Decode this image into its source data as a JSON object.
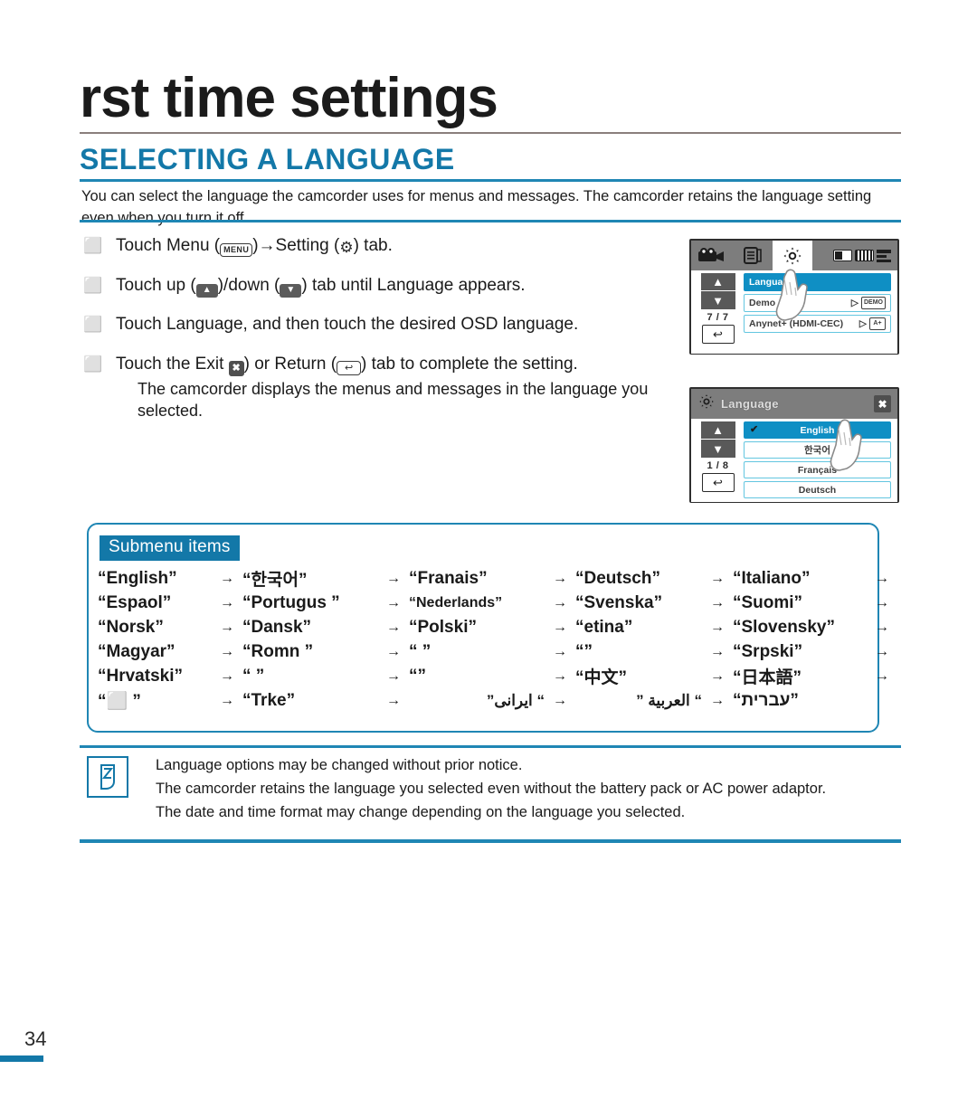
{
  "header": {
    "chapter_title": "rst time settings",
    "section_title": "SELECTING A LANGUAGE",
    "intro": "You can select the language the camcorder uses for menus and messages. The camcorder retains the language setting even when you turn it off."
  },
  "steps": [
    {
      "bullet": "⬜",
      "pre": "Touch Menu (",
      "icon1": "MENU",
      "mid": ")→Setting (",
      "icon2": "⚙",
      "post": ") tab."
    },
    {
      "bullet": "⬜",
      "pre": "Touch up (",
      "icon1": "▲",
      "mid": ")/down (",
      "icon2": "▼",
      "post": ") tab until  Language  appears."
    },
    {
      "bullet": "⬜",
      "text": "Touch  Language,  and then touch the desired OSD language."
    },
    {
      "bullet": "⬜",
      "pre": "Touch the Exit ",
      "icon1": "✖",
      "mid": ") or Return (",
      "icon2": "↩",
      "post": ") tab to complete the setting.",
      "sub": "The camcorder displays the menus and messages in the language you selected."
    }
  ],
  "lcd_setting": {
    "tabs": {
      "camera_icon": "camcorder-icon",
      "list_icon": "playback-icon",
      "gear_icon": "setting-icon"
    },
    "status_icons": [
      "memory-icon",
      "battery-icon",
      "card-icon"
    ],
    "nav": {
      "up": "▲",
      "down": "▼",
      "page": "7 / 7",
      "return": "↩"
    },
    "rows": [
      {
        "label": "Language",
        "selected": true,
        "value": "",
        "badge": ""
      },
      {
        "label": "Demo",
        "selected": false,
        "value": "▷",
        "badge": "DEMO"
      },
      {
        "label": "Anynet+ (HDMI-CEC)",
        "selected": false,
        "value": "▷",
        "badge": "A+"
      }
    ]
  },
  "lcd_language": {
    "header_title": "Language",
    "header_gear_icon": "setting-icon",
    "close_icon": "✖",
    "nav": {
      "up": "▲",
      "down": "▼",
      "page": "1 / 8",
      "return": "↩"
    },
    "rows": [
      {
        "label": "English",
        "selected": true,
        "check": "✔"
      },
      {
        "label": "한국어",
        "selected": false,
        "check": ""
      },
      {
        "label": "Français",
        "selected": false,
        "check": ""
      },
      {
        "label": "Deutsch",
        "selected": false,
        "check": ""
      }
    ]
  },
  "submenu": {
    "label": "Submenu items",
    "arrow": "→",
    "rows": [
      [
        "“English”",
        "“한국어”",
        "“Franais”",
        "“Deutsch”",
        "“Italiano”"
      ],
      [
        "“Espaol”",
        "“Portugus ”",
        "“Nederlands”",
        "“Svenska”",
        "“Suomi”"
      ],
      [
        "“Norsk”",
        "“Dansk”",
        "“Polski”",
        "“etina”",
        "“Slovensky”"
      ],
      [
        "“Magyar”",
        "“Romn  ”",
        "“           ”",
        "“”",
        "“Srpski”"
      ],
      [
        "“Hrvatski”",
        "“           ”",
        "“”",
        "“中文”",
        "“日本語”"
      ],
      [
        "“⬜ ”",
        "“Trke”",
        "“ ايرانى”",
        "“ العربية ”",
        "“עברית”"
      ]
    ]
  },
  "notes": {
    "icon": "note-icon",
    "lines": [
      "Language  options may be changed without prior notice.",
      "The camcorder retains the language you selected even without the battery pack or AC power adaptor.",
      "The date and time format may change depending on the language you selected."
    ]
  },
  "footer": {
    "page_number": "34"
  },
  "colors": {
    "accent_blue": "#1378a8",
    "rule_blue": "#1f86b4",
    "lcd_selected": "#0f8fc4",
    "lcd_border": "#63c6e0",
    "lcd_bar_gray": "#7d7d7d"
  }
}
